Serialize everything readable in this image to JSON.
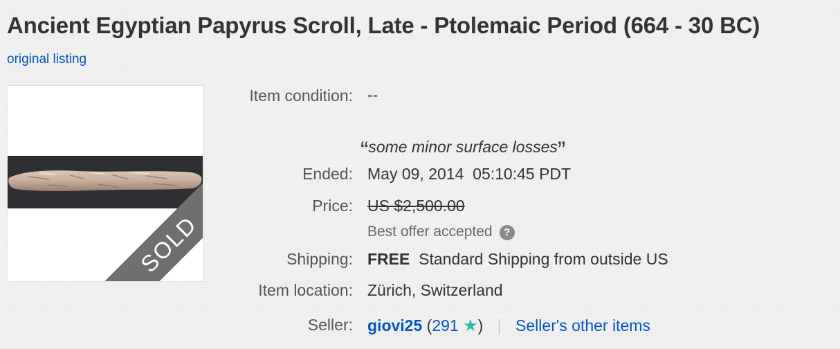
{
  "listing": {
    "title": "Ancient Egyptian Papyrus Scroll, Late - Ptolemaic Period (664 - 30 BC)",
    "original_listing_link": "original listing"
  },
  "photo": {
    "sold_ribbon": "SOLD"
  },
  "details": {
    "condition_label": "Item condition:",
    "condition_value": "--",
    "condition_note": "some minor surface losses",
    "quote_open": "“",
    "quote_close": "”",
    "ended_label": "Ended:",
    "ended_date": "May 09, 2014",
    "ended_time": "05:10:45 PDT",
    "price_label": "Price:",
    "price_value": "US $2,500.00",
    "best_offer_text": "Best offer accepted",
    "help_icon_glyph": "?",
    "shipping_label": "Shipping:",
    "shipping_free": "FREE",
    "shipping_desc": "Standard Shipping from outside US",
    "location_label": "Item location:",
    "location_value": "Zürich, Switzerland",
    "seller_label": "Seller:",
    "seller_name": "giovi25",
    "seller_open_paren": "(",
    "seller_score": "291",
    "seller_close_paren": ")",
    "seller_star_icon": "star-icon",
    "seller_separator": "|",
    "seller_other_items": "Seller's other items"
  },
  "colors": {
    "link": "#0654ba",
    "star": "#2fb8a6",
    "ribbon": "#6f6f6f"
  }
}
